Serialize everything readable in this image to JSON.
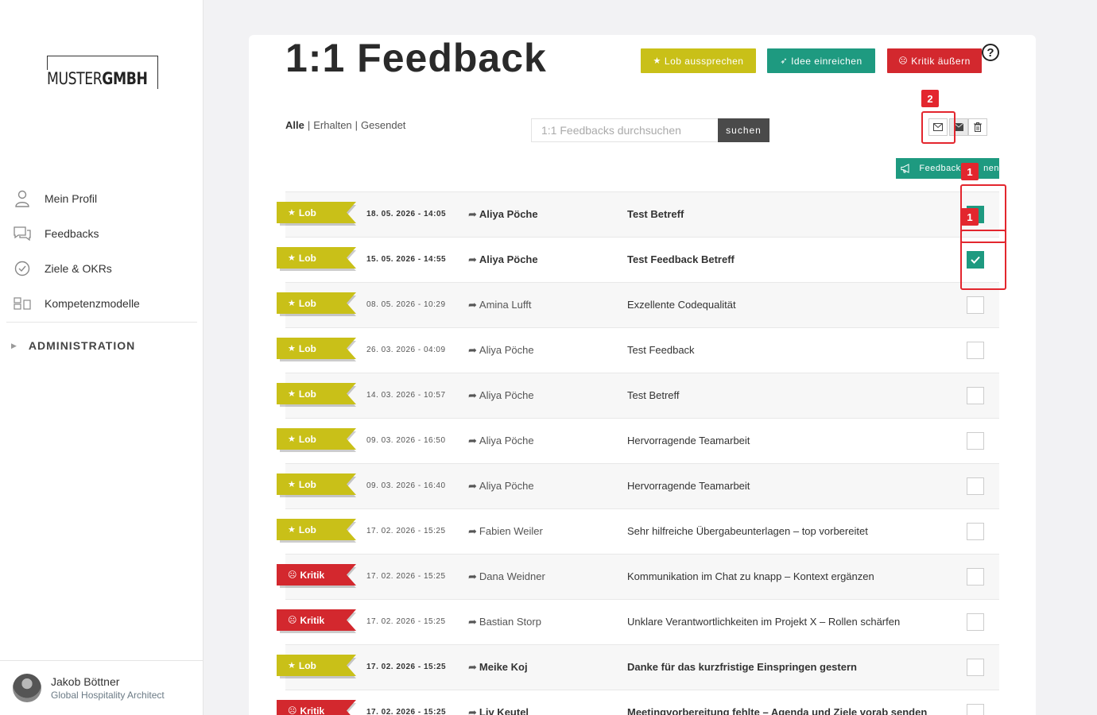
{
  "brand": {
    "logo_light": "MUSTER",
    "logo_bold": "GMBH"
  },
  "sidebar": {
    "items": [
      {
        "label": "Mein Profil",
        "icon": "user-icon"
      },
      {
        "label": "Feedbacks",
        "icon": "chat-icon"
      },
      {
        "label": "Ziele & OKRs",
        "icon": "check-circle-icon"
      },
      {
        "label": "Kompetenzmodelle",
        "icon": "blocks-icon"
      }
    ],
    "admin_label": "ADMINISTRATION"
  },
  "user": {
    "name": "Jakob Böttner",
    "role": "Global Hospitality Architect"
  },
  "header": {
    "title": "1:1 Feedback",
    "btn_lob": "Lob aussprechen",
    "btn_idee": "Idee einreichen",
    "btn_kritik": "Kritik äußern"
  },
  "filters": {
    "all": "Alle",
    "received": "Erhalten",
    "sent": "Gesendet"
  },
  "search": {
    "placeholder": "1:1 Feedbacks durchsuchen",
    "button": "suchen"
  },
  "export_label": "Feedback        nen",
  "annotations": {
    "a1": "1",
    "a1b": "1",
    "a2": "2"
  },
  "colors": {
    "lob": "#c9c018",
    "idee": "#1e9a80",
    "kritik": "#d3282e",
    "annotation": "#e3262e"
  },
  "rows": [
    {
      "type": "Lob",
      "date": "18. 05. 2026 - 14:05",
      "sender": "Aliya Pöche",
      "subject": "Test Betreff",
      "bold": true,
      "checked": true
    },
    {
      "type": "Lob",
      "date": "15. 05. 2026 - 14:55",
      "sender": "Aliya Pöche",
      "subject": "Test Feedback Betreff",
      "bold": true,
      "checked": true
    },
    {
      "type": "Lob",
      "date": "08. 05. 2026 - 10:29",
      "sender": "Amina Lufft",
      "subject": "Exzellente Codequalität",
      "bold": false,
      "checked": false
    },
    {
      "type": "Lob",
      "date": "26. 03. 2026 - 04:09",
      "sender": "Aliya Pöche",
      "subject": "Test Feedback",
      "bold": false,
      "checked": false
    },
    {
      "type": "Lob",
      "date": "14. 03. 2026 - 10:57",
      "sender": "Aliya Pöche",
      "subject": "Test Betreff",
      "bold": false,
      "checked": false
    },
    {
      "type": "Lob",
      "date": "09. 03. 2026 - 16:50",
      "sender": "Aliya Pöche",
      "subject": "Hervorragende Teamarbeit",
      "bold": false,
      "checked": false
    },
    {
      "type": "Lob",
      "date": "09. 03. 2026 - 16:40",
      "sender": "Aliya Pöche",
      "subject": "Hervorragende Teamarbeit",
      "bold": false,
      "checked": false
    },
    {
      "type": "Lob",
      "date": "17. 02. 2026 - 15:25",
      "sender": "Fabien Weiler",
      "subject": "Sehr hilfreiche Übergabeunterlagen – top vorbereitet",
      "bold": false,
      "checked": false
    },
    {
      "type": "Kritik",
      "date": "17. 02. 2026 - 15:25",
      "sender": "Dana Weidner",
      "subject": "Kommunikation im Chat zu knapp – Kontext ergänzen",
      "bold": false,
      "checked": false
    },
    {
      "type": "Kritik",
      "date": "17. 02. 2026 - 15:25",
      "sender": "Bastian Storp",
      "subject": "Unklare Verantwortlichkeiten im Projekt X – Rollen schärfen",
      "bold": false,
      "checked": false
    },
    {
      "type": "Lob",
      "date": "17. 02. 2026 - 15:25",
      "sender": "Meike Koj",
      "subject": "Danke für das kurzfristige Einspringen gestern",
      "bold": true,
      "checked": false
    },
    {
      "type": "Kritik",
      "date": "17. 02. 2026 - 15:25",
      "sender": "Liv Keutel",
      "subject": "Meetingvorbereitung fehlte – Agenda und Ziele vorab senden",
      "bold": true,
      "checked": false
    }
  ]
}
